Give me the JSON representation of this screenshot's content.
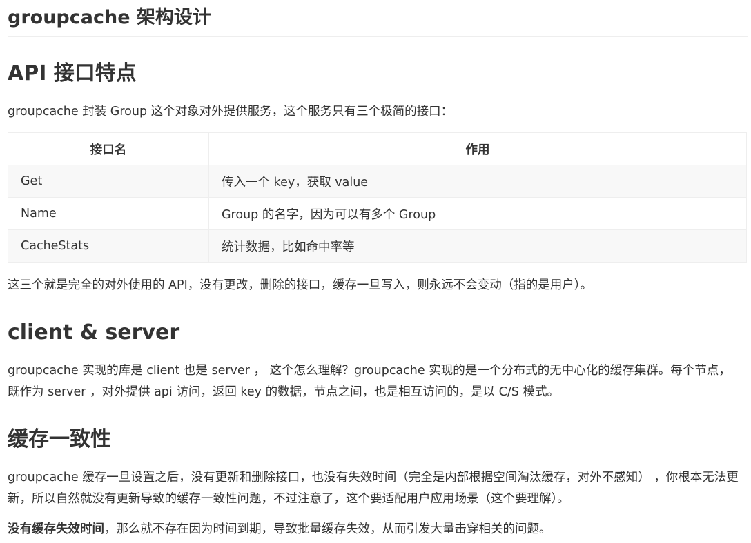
{
  "title": "groupcache 架构设计",
  "sections": {
    "api": {
      "heading": "API 接口特点",
      "intro": "groupcache 封装 Group 这个对象对外提供服务，这个服务只有三个极简的接口：",
      "table": {
        "headers": [
          "接口名",
          "作用"
        ],
        "rows": [
          [
            "Get",
            "传入一个 key，获取 value"
          ],
          [
            "Name",
            "Group 的名字，因为可以有多个 Group"
          ],
          [
            "CacheStats",
            "统计数据，比如命中率等"
          ]
        ]
      },
      "after": "这三个就是完全的对外使用的 API，没有更改，删除的接口，缓存一旦写入，则永远不会变动（指的是用户）。"
    },
    "client_server": {
      "heading": "client & server",
      "text": "groupcache 实现的库是 client 也是 server ， 这个怎么理解？groupcache 实现的是一个分布式的无中心化的缓存集群。每个节点，既作为 server ，对外提供 api 访问，返回 key 的数据，节点之间，也是相互访问的，是以 C/S 模式。"
    },
    "consistency": {
      "heading": "缓存一致性",
      "text1": "groupcache 缓存一旦设置之后，没有更新和删除接口，也没有失效时间（完全是内部根据空间淘汰缓存，对外不感知） ，你根本无法更新，所以自然就没有更新导致的缓存一致性问题，不过注意了，这个要适配用户应用场景（这个要理解）。",
      "text2_bold": "没有缓存失效时间",
      "text2_rest": "，那么就不存在因为时间到期，导致批量缓存失效，从而引发大量击穿相关的问题。"
    }
  }
}
